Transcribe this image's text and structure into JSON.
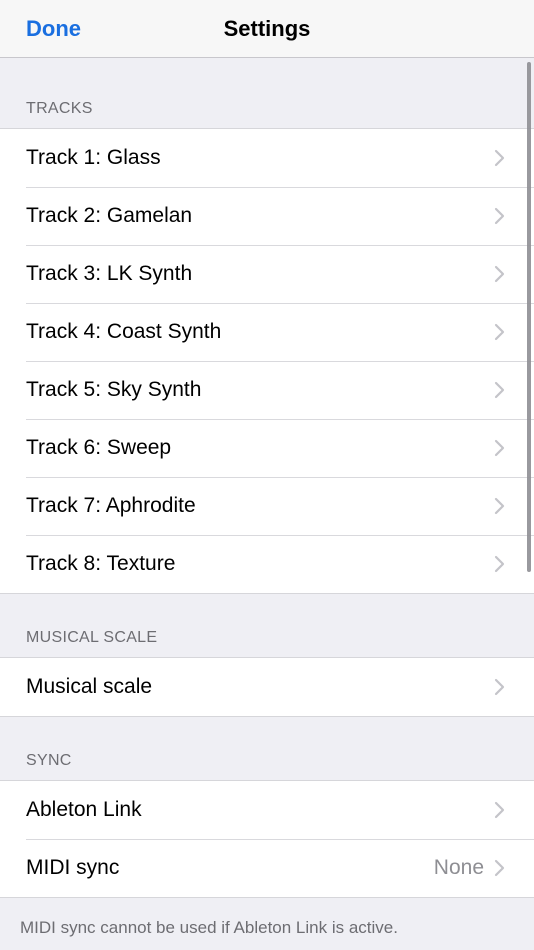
{
  "navbar": {
    "done_label": "Done",
    "title": "Settings"
  },
  "sections": {
    "tracks": {
      "header": "TRACKS",
      "items": [
        {
          "label": "Track 1: Glass"
        },
        {
          "label": "Track 2: Gamelan"
        },
        {
          "label": "Track 3: LK Synth"
        },
        {
          "label": "Track 4: Coast Synth"
        },
        {
          "label": "Track 5: Sky Synth"
        },
        {
          "label": "Track 6: Sweep"
        },
        {
          "label": "Track 7: Aphrodite"
        },
        {
          "label": "Track 8: Texture"
        }
      ]
    },
    "musical_scale": {
      "header": "MUSICAL SCALE",
      "items": [
        {
          "label": "Musical scale"
        }
      ]
    },
    "sync": {
      "header": "SYNC",
      "items": [
        {
          "label": "Ableton Link"
        },
        {
          "label": "MIDI sync",
          "detail": "None"
        }
      ],
      "footer": "MIDI sync cannot be used if Ableton Link is active."
    }
  },
  "icons": {
    "row_disclosure": "chevron-right-icon"
  },
  "colors": {
    "accent": "#1a6fe0",
    "background": "#efeff4",
    "section_text": "#6d6d72",
    "chevron": "#c4c4c9"
  }
}
